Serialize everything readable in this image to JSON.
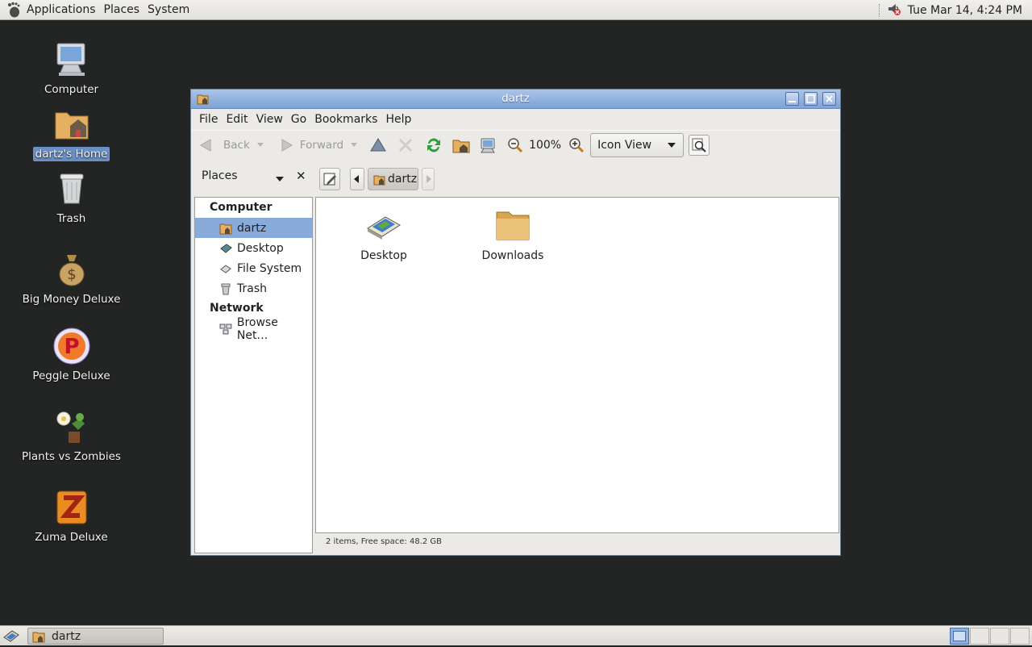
{
  "top_panel": {
    "menus": [
      "Applications",
      "Places",
      "System"
    ],
    "clock": "Tue Mar 14,  4:24 PM"
  },
  "desktop": {
    "icons": [
      {
        "label": "Computer",
        "icon": "computer-icon"
      },
      {
        "label": "dartz's Home",
        "icon": "home-folder-icon"
      },
      {
        "label": "Trash",
        "icon": "trash-icon"
      },
      {
        "label": "Big Money Deluxe",
        "icon": "money-bag-icon"
      },
      {
        "label": "Peggle Deluxe",
        "icon": "peggle-icon"
      },
      {
        "label": "Plants vs Zombies",
        "icon": "plants-icon"
      },
      {
        "label": "Zuma Deluxe",
        "icon": "zuma-icon"
      }
    ]
  },
  "window": {
    "title": "dartz",
    "menus": [
      "File",
      "Edit",
      "View",
      "Go",
      "Bookmarks",
      "Help"
    ],
    "toolbar": {
      "back": "Back",
      "forward": "Forward",
      "zoom": "100%",
      "view_mode": "Icon View"
    },
    "places_title": "Places",
    "breadcrumb": "dartz",
    "sidebar": {
      "sections": [
        {
          "header": "Computer",
          "items": [
            {
              "label": "dartz",
              "icon": "home-folder-icon"
            },
            {
              "label": "Desktop",
              "icon": "desktop-icon"
            },
            {
              "label": "File System",
              "icon": "drive-icon"
            },
            {
              "label": "Trash",
              "icon": "trash-icon"
            }
          ]
        },
        {
          "header": "Network",
          "items": [
            {
              "label": "Browse Net…",
              "icon": "network-icon"
            }
          ]
        }
      ]
    },
    "files": [
      {
        "label": "Desktop",
        "icon": "desktop-folder-icon"
      },
      {
        "label": "Downloads",
        "icon": "folder-icon"
      }
    ],
    "status": "2 items, Free space: 48.2 GB"
  },
  "taskbar": {
    "task": "dartz"
  },
  "colors": {
    "desktop_bg": "#232524",
    "titlebar": "#8eafdd",
    "selection": "#89abd9"
  }
}
